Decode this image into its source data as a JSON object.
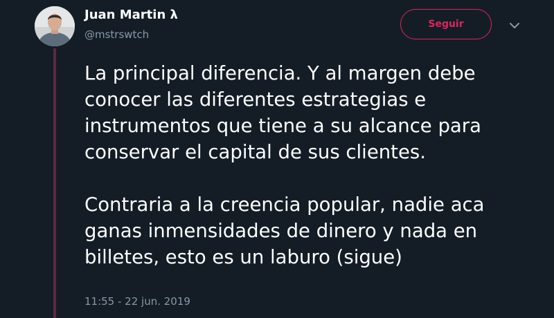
{
  "tweet": {
    "author": {
      "display_name": "Juan Martin λ",
      "handle": "@mstrswtch"
    },
    "follow_button": {
      "label": "Seguir"
    },
    "text": "La principal diferencia. Y al margen debe conocer las diferentes estrategias e instrumentos que tiene a su alcance para conservar el capital de sus clientes.\n\nContraria a la creencia popular, nadie aca ganas inmensidades de dinero y nada en billetes, esto es un laburo (sigue)",
    "timestamp": "11:55 - 22 jun. 2019"
  },
  "colors": {
    "background": "#141d26",
    "text_primary": "#ffffff",
    "text_secondary": "#8899a6",
    "accent": "#e0245e",
    "thread_line": "#5a2a3e"
  },
  "icons": {
    "more_menu": "chevron-down-icon",
    "avatar": "profile-photo"
  }
}
